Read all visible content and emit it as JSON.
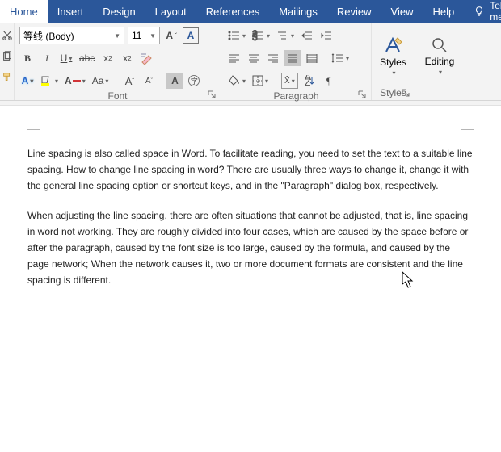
{
  "tabs": {
    "home": "Home",
    "insert": "Insert",
    "design": "Design",
    "layout": "Layout",
    "references": "References",
    "mailings": "Mailings",
    "review": "Review",
    "view": "View",
    "help": "Help",
    "tellme": "Tell me"
  },
  "font": {
    "name_value": "等线 (Body)",
    "size_value": "11",
    "group_label": "Font",
    "bold": "B",
    "italic": "I"
  },
  "paragraph": {
    "group_label": "Paragraph"
  },
  "styles": {
    "group_label": "Styles",
    "button": "Styles"
  },
  "editing": {
    "button": "Editing"
  },
  "doc": {
    "p1": "Line spacing is also called space in Word. To facilitate reading, you need to set the text to a suitable line spacing. How to change line spacing in word? There are usually three ways to change it, change it with the general line spacing option or shortcut keys, and in the \"Paragraph\" dialog box, respectively.",
    "p2": "When adjusting the line spacing, there are often situations that cannot be adjusted, that is, line spacing in word not working. They are roughly divided into four cases, which are caused by the space before or after the paragraph, caused by the font size is too large, caused by the formula, and caused by the page network; When the network causes it, two or more document formats are consistent and the line spacing is different."
  },
  "colors": {
    "accent": "#2b579a"
  }
}
